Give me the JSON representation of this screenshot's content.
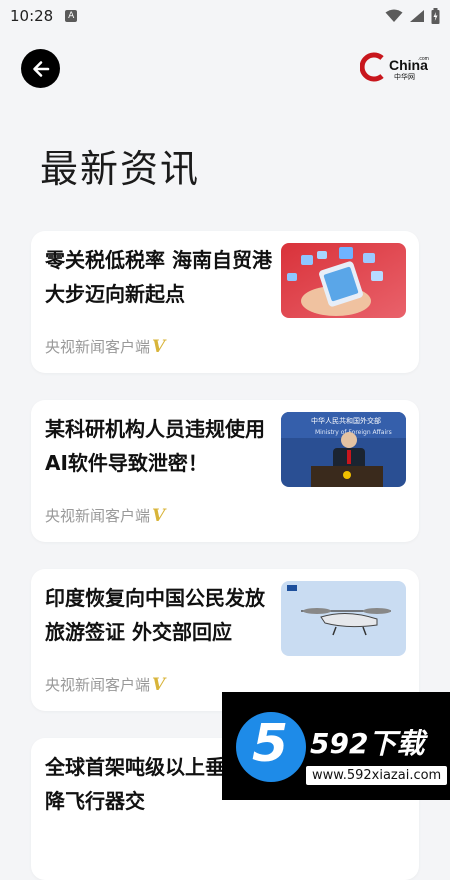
{
  "status_bar": {
    "time": "10:28",
    "notification_icon": "a-icon",
    "wifi_icon": "wifi-icon",
    "signal_icon": "signal-icon",
    "battery_icon": "battery-icon"
  },
  "header": {
    "back_icon": "back-arrow-icon",
    "logo_text": "China",
    "logo_subtext": "中华网",
    "logo_com": ".com"
  },
  "page_title": "最新资讯",
  "articles": [
    {
      "title": "零关税低税率 海南自贸港大步迈向新起点",
      "source": "央视新闻客户端",
      "badge": "V",
      "thumb": "phone-hands-image"
    },
    {
      "title": "某科研机构人员违规使用AI软件导致泄密！",
      "source": "央视新闻客户端",
      "badge": "V",
      "thumb": "press-conference-image"
    },
    {
      "title": "印度恢复向中国公民发放旅游签证 外交部回应",
      "source": "央视新闻客户端",
      "badge": "V",
      "thumb": "evtol-aircraft-image"
    },
    {
      "title": "全球首架吨级以上垂直起降飞行器交",
      "source": "",
      "badge": "",
      "thumb": ""
    }
  ],
  "thumb_captions": {
    "press_banner": "中华人民共和国外交部",
    "press_banner_en": "Ministry of Foreign Affairs"
  },
  "watermark": {
    "digit": "5",
    "brand": "592下载",
    "url": "www.592xiazai.com"
  },
  "colors": {
    "background": "#f4f5f7",
    "card": "#ffffff",
    "source_text": "#999999",
    "verified_badge": "#d8b43a",
    "logo_red": "#c8161d",
    "watermark_blue": "#1e8be8"
  }
}
